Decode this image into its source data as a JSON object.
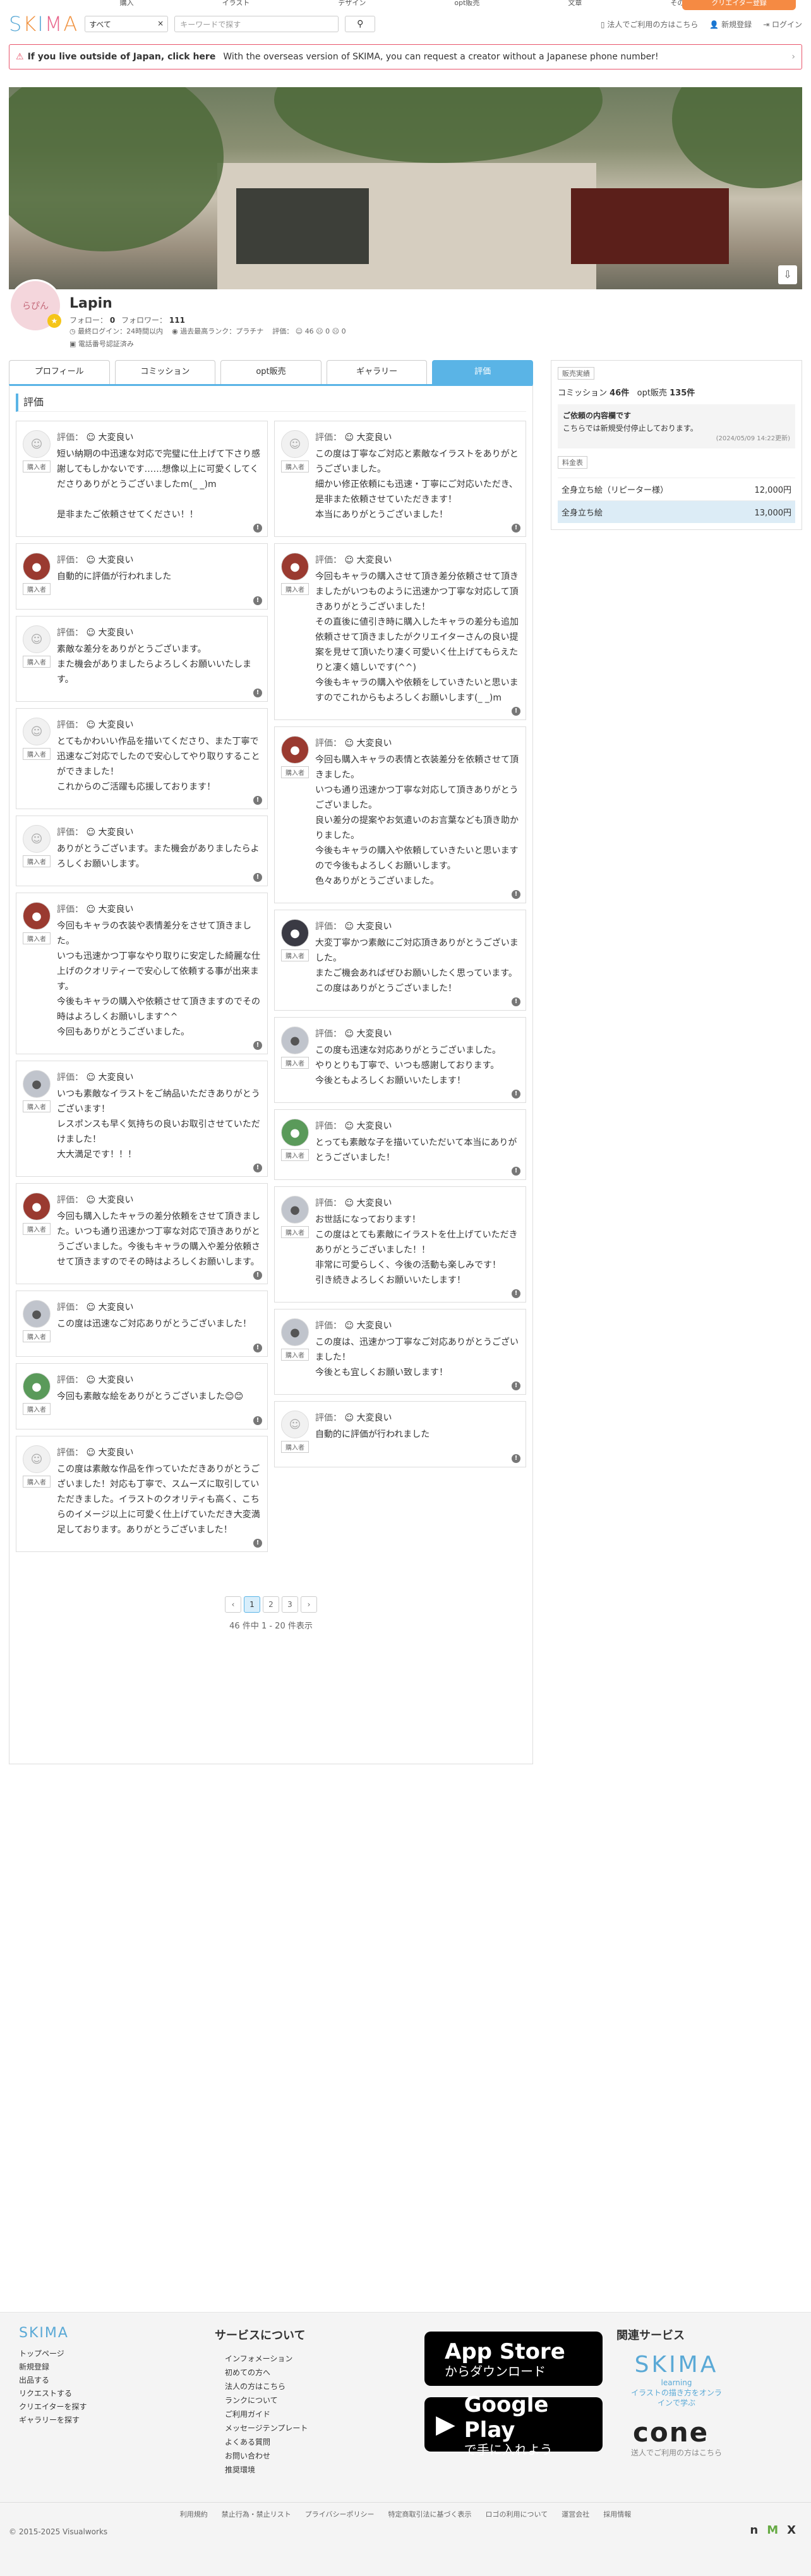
{
  "topnav": {
    "items": [
      "購入",
      "イラスト",
      "デザイン",
      "opt販売",
      "文章",
      "その他"
    ],
    "cta": "クリエイター登録"
  },
  "header": {
    "logo": "SKIMA",
    "category": "すべて",
    "search_placeholder": "キーワードで探す",
    "corp": "法人でご利用の方はこちら",
    "signup": "新規登録",
    "login": "ログイン"
  },
  "notice": {
    "strong": "If you live outside of Japan, click here",
    "text": "With the overseas version of SKIMA, you can request a creator without a Japanese phone number!"
  },
  "profile": {
    "name": "Lapin",
    "avatar_text": "らぴん",
    "follow_label": "フォロー：",
    "follow": "0",
    "follower_label": "フォロワー：",
    "follower": "111",
    "last_login": "最終ログイン：24時間以内",
    "rank": "過去最高ランク：プラチナ",
    "rating_label": "評価：",
    "good": "46",
    "normal": "0",
    "bad": "0",
    "phone": "電話番号認証済み"
  },
  "tabs": [
    "プロフィール",
    "コミッション",
    "opt販売",
    "ギャラリー",
    "評価"
  ],
  "reviews": {
    "title": "評価",
    "label": "評価：",
    "face": "大変良い",
    "buyer": "購入者",
    "left": [
      {
        "av": "",
        "text": "短い納期の中迅速な対応で完璧に仕上げて下さり感謝してもしかないです……想像以上に可愛くしてくださりありがとうございましたm(_ _)m\n\n是非またご依頼させてください！！"
      },
      {
        "av": "img1",
        "text": "自動的に評価が行われました"
      },
      {
        "av": "",
        "text": "素敵な差分をありがとうございます。\nまた機会がありましたらよろしくお願いいたします。"
      },
      {
        "av": "",
        "text": "とてもかわいい作品を描いてくださり、また丁寧で迅速なご対応でしたので安心してやり取りすることができました！\nこれからのご活躍も応援しております！"
      },
      {
        "av": "",
        "text": "ありがとうございます。また機会がありましたらよろしくお願いします。"
      },
      {
        "av": "img1",
        "text": "今回もキャラの衣装や表情差分をさせて頂きました。\nいつも迅速かつ丁寧なやり取りに安定した綺麗な仕上げのクオリティーで安心して依頼する事が出来ます。\n今後もキャラの購入や依頼させて頂きますのでその時はよろしくお願いします^^\n今回もありがとうございました。"
      },
      {
        "av": "img4",
        "text": "いつも素敵なイラストをご納品いただきありがとうございます！\nレスポンスも早く気持ちの良いお取引させていただけました！\n大大満足です！！！"
      },
      {
        "av": "img1",
        "text": "今回も購入したキャラの差分依頼をさせて頂きました。いつも通り迅速かつ丁寧な対応で頂きありがとうございました。今後もキャラの購入や差分依頼させて頂きますのでその時はよろしくお願いします。"
      },
      {
        "av": "img4",
        "text": "この度は迅速なご対応ありがとうございました！"
      },
      {
        "av": "img3",
        "text": "今回も素敵な絵をありがとうございました😊😊"
      },
      {
        "av": "",
        "text": "この度は素敵な作品を作っていただきありがとうございました！対応も丁寧で、スムーズに取引していただきました。イラストのクオリティも高く、こちらのイメージ以上に可愛く仕上げていただき大変満足しております。ありがとうございました！"
      }
    ],
    "right": [
      {
        "av": "",
        "text": "この度は丁寧なご対応と素敵なイラストをありがとうございました。\n細かい修正依頼にも迅速・丁寧にご対応いただき、是非また依頼させていただきます！\n本当にありがとうございました！"
      },
      {
        "av": "img1",
        "text": "今回もキャラの購入させて頂き差分依頼させて頂きましたがいつものように迅速かつ丁寧な対応して頂きありがとうございました！\nその直後に値引き時に購入したキャラの差分も追加依頼させて頂きましたがクリエイターさんの良い提案を見せて頂いたり凄く可愛いく仕上げてもらえたりと凄く嬉しいです(^^)\n今後もキャラの購入や依頼をしていきたいと思いますのでこれからもよろしくお願いします(_ _)m"
      },
      {
        "av": "img1",
        "text": "今回も購入キャラの表情と衣装差分を依頼させて頂きました。\nいつも通り迅速かつ丁寧な対応して頂きありがとうございました。\n良い差分の提案やお気遣いのお言葉なども頂き助かりました。\n今後もキャラの購入や依頼していきたいと思いますので今後もよろしくお願いします。\n色々ありがとうございました。"
      },
      {
        "av": "img2",
        "text": "大変丁寧かつ素敵にご対応頂きありがとうございました。\nまたご機会あればぜひお願いしたく思っています。\nこの度はありがとうございました！"
      },
      {
        "av": "img4",
        "text": "この度も迅速な対応ありがとうございました。\nやりとりも丁寧で、いつも感謝しております。\n今後ともよろしくお願いいたします！"
      },
      {
        "av": "img3",
        "text": "とっても素敵な子を描いていただいて本当にありがとうございました！"
      },
      {
        "av": "img4",
        "text": "お世話になっております！\nこの度はとても素敵にイラストを仕上げていただきありがとうございました！！\n非常に可愛らしく、今後の活動も楽しみです！\n引き続きよろしくお願いいたします！"
      },
      {
        "av": "img4",
        "text": "この度は、迅速かつ丁寧なご対応ありがとうございました！\n今後とも宜しくお願い致します！"
      },
      {
        "av": "",
        "text": "自動的に評価が行われました"
      }
    ]
  },
  "pager": {
    "prev": "‹",
    "pages": [
      "1",
      "2",
      "3"
    ],
    "next": "›",
    "summary": "46 件中 1 - 20 件表示"
  },
  "sidebar": {
    "label": "販売実績",
    "commission_label": "コミッション",
    "commission": "46件",
    "opt_label": "opt販売",
    "opt": "135件",
    "info_title": "ご依頼の内容欄です",
    "info_text": "こちらでは新規受付停止しております。",
    "info_date": "(2024/05/09 14:22更新)",
    "price_label": "料金表",
    "prices": [
      {
        "name": "全身立ち絵（リピーター様）",
        "price": "12,000円"
      },
      {
        "name": "全身立ち絵",
        "price": "13,000円"
      }
    ]
  },
  "footer": {
    "logo": "SKIMA",
    "links": [
      "トップページ",
      "新規登録",
      "出品する",
      "リクエストする",
      "クリエイターを探す",
      "ギャラリーを探す"
    ],
    "about_title": "サービスについて",
    "about_links": [
      "インフォメーション",
      "初めての方へ",
      "法人の方はこちら",
      "ランクについて",
      "ご利用ガイド",
      "メッセージテンプレート",
      "よくある質問",
      "お問い合わせ",
      "推奨環境"
    ],
    "appstore": "App Store",
    "appstore_sub": "からダウンロード",
    "gplay": "Google Play",
    "gplay_sub": "で手に入れよう",
    "related_title": "関連サービス",
    "skima_learning": "SKIMA",
    "learning": "learning",
    "learning_sub": "イラストの描き方をオンラインで学ぶ",
    "cone": "cone",
    "cone_sub": "送人でご利用の方はこちら",
    "bottom_links": [
      "利用規約",
      "禁止行為・禁止リスト",
      "プライバシーポリシー",
      "特定商取引法に基づく表示",
      "ロゴの利用について",
      "運営会社",
      "採用情報"
    ],
    "copyright": "© 2015-2025 Visualworks"
  }
}
